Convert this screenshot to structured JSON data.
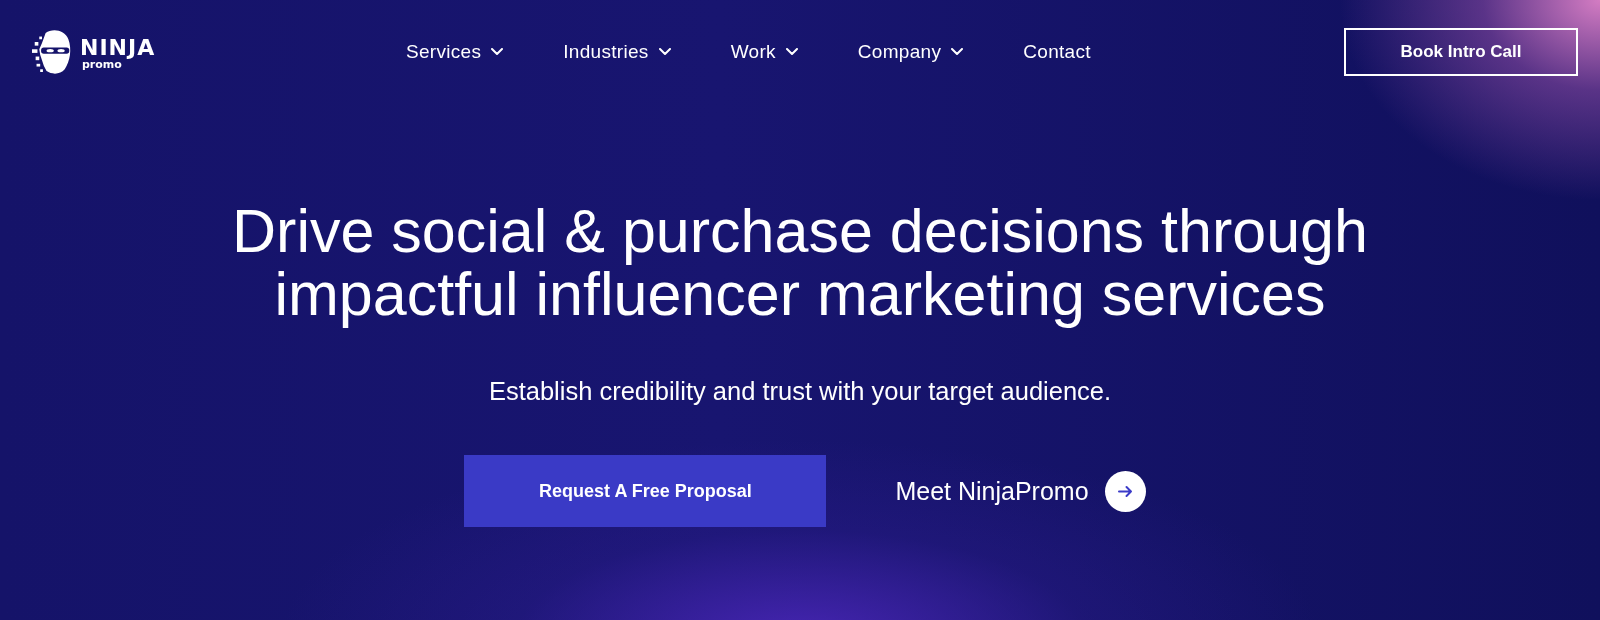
{
  "logo": {
    "wordmark": "NINJA",
    "subtitle": "promo"
  },
  "nav": {
    "items": [
      {
        "label": "Services",
        "has_dropdown": true
      },
      {
        "label": "Industries",
        "has_dropdown": true
      },
      {
        "label": "Work",
        "has_dropdown": true
      },
      {
        "label": "Company",
        "has_dropdown": true
      },
      {
        "label": "Contact",
        "has_dropdown": false
      }
    ]
  },
  "header_button": "Book Intro Call",
  "hero": {
    "headline": [
      "Drive social & purchase decisions through",
      "impactful influencer marketing services"
    ],
    "subtitle": "Establish credibility and trust with your target audience.",
    "primary_button": "Request A Free Proposal",
    "secondary_link": "Meet NinjaPromo"
  }
}
